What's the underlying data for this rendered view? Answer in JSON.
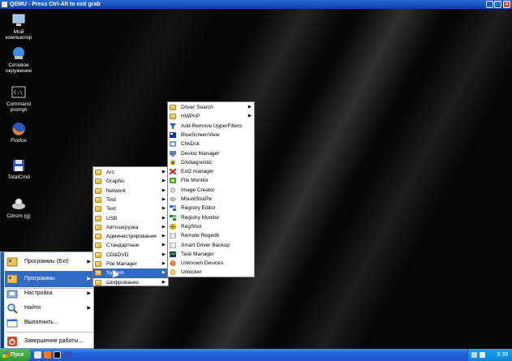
{
  "window": {
    "title": "QEMU - Press Ctrl-Alt to exit grab"
  },
  "desktop_icons": [
    {
      "label": "Мой компьютер",
      "icon": "computer-icon"
    },
    {
      "label": "Сетевое окружение",
      "icon": "network-icon"
    },
    {
      "label": "Command prompt",
      "icon": "cmd-icon"
    },
    {
      "label": "Firefox",
      "icon": "firefox-icon"
    },
    {
      "label": "TotalCmd",
      "icon": "floppy-icon"
    },
    {
      "label": "Cdrom (g)",
      "icon": "cdrom-icon"
    }
  ],
  "start_menu": {
    "items": [
      {
        "label": "Программы (Ext)",
        "icon": "programs-ext-icon",
        "arrow": "▶"
      },
      {
        "label": "Программы",
        "icon": "programs-icon",
        "arrow": "▶"
      },
      {
        "label": "Настройка",
        "icon": "settings-icon",
        "arrow": "▶"
      },
      {
        "label": "Найти",
        "icon": "search-icon",
        "arrow": "▶"
      },
      {
        "label": "Выполнить...",
        "icon": "run-icon",
        "arrow": ""
      },
      {
        "label": "Завершение работы...",
        "icon": "shutdown-icon",
        "arrow": ""
      }
    ]
  },
  "programs_menu": {
    "items": [
      {
        "label": "Arc",
        "arrow": "▶"
      },
      {
        "label": "Graphic",
        "arrow": "▶"
      },
      {
        "label": "Network",
        "arrow": "▶"
      },
      {
        "label": "Test",
        "arrow": "▶"
      },
      {
        "label": "Text",
        "arrow": "▶"
      },
      {
        "label": "USB",
        "arrow": "▶"
      },
      {
        "label": "Автозагрузка",
        "arrow": "▶"
      },
      {
        "label": "Администрирование",
        "arrow": "▶"
      },
      {
        "label": "Стандартные",
        "arrow": "▶"
      },
      {
        "label": "CD&DVD",
        "arrow": "▶"
      },
      {
        "label": "File Manager",
        "arrow": "▶"
      },
      {
        "label": "System",
        "arrow": "▶"
      },
      {
        "label": "Шифрование",
        "arrow": "▶"
      }
    ]
  },
  "system_menu": {
    "items": [
      {
        "label": "Driver Search",
        "icon": "folder-icon",
        "arrow": "▶"
      },
      {
        "label": "HWPnP",
        "icon": "folder-icon",
        "arrow": "▶"
      },
      {
        "label": "Add-Remove UpperFilters",
        "icon": "filter-icon",
        "arrow": ""
      },
      {
        "label": "BlueScreenView",
        "icon": "bluescreen-icon",
        "arrow": ""
      },
      {
        "label": "ChkDsk",
        "icon": "disk-icon",
        "arrow": ""
      },
      {
        "label": "Device Manager",
        "icon": "device-icon",
        "arrow": ""
      },
      {
        "label": "DXdiagnostic",
        "icon": "dx-icon",
        "arrow": ""
      },
      {
        "label": "Ext2 manager",
        "icon": "ext2-icon",
        "arrow": ""
      },
      {
        "label": "File Monitor",
        "icon": "file-monitor-icon",
        "arrow": ""
      },
      {
        "label": "Image Creator",
        "icon": "image-creator-icon",
        "arrow": ""
      },
      {
        "label": "MountStorPe",
        "icon": "mount-icon",
        "arrow": ""
      },
      {
        "label": "Registry Editor",
        "icon": "registry-editor-icon",
        "arrow": ""
      },
      {
        "label": "Registry Monitor",
        "icon": "registry-monitor-icon",
        "arrow": ""
      },
      {
        "label": "RegShot",
        "icon": "regshot-icon",
        "arrow": ""
      },
      {
        "label": "Remote Regedit",
        "icon": "remote-regedit-icon",
        "arrow": ""
      },
      {
        "label": "Smart Driver Backup",
        "icon": "backup-icon",
        "arrow": ""
      },
      {
        "label": "Task Manager",
        "icon": "task-manager-icon",
        "arrow": ""
      },
      {
        "label": "Unknown Devices",
        "icon": "unknown-devices-icon",
        "arrow": ""
      },
      {
        "label": "Unlocker",
        "icon": "unlocker-icon",
        "arrow": ""
      }
    ]
  },
  "taskbar": {
    "start_label": "Пуск",
    "clock": "9:39"
  }
}
